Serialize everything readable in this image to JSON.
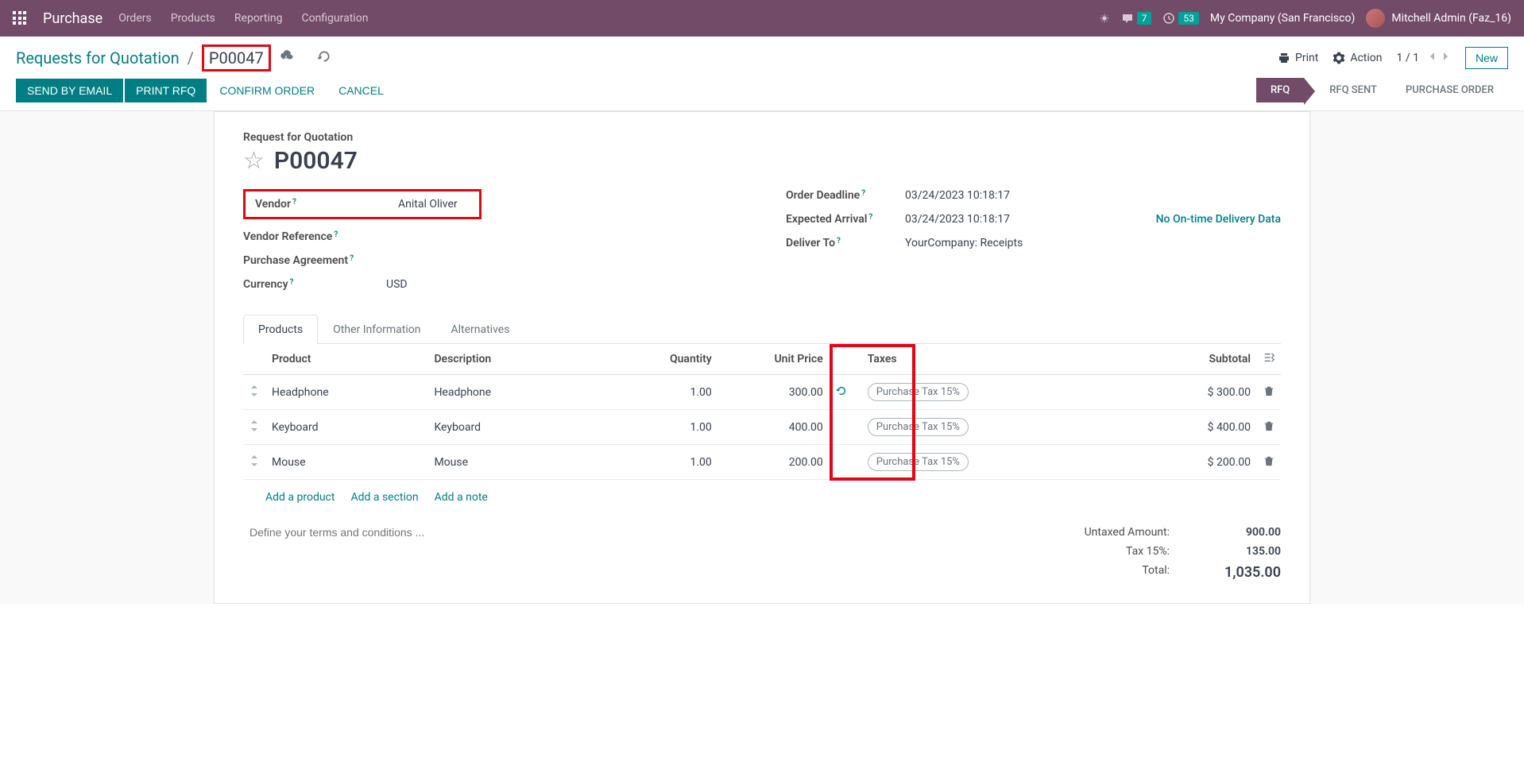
{
  "navbar": {
    "brand": "Purchase",
    "menu": [
      "Orders",
      "Products",
      "Reporting",
      "Configuration"
    ],
    "messages_badge": "7",
    "activities_badge": "53",
    "company": "My Company (San Francisco)",
    "user": "Mitchell Admin (Faz_16)"
  },
  "breadcrumb": {
    "root": "Requests for Quotation",
    "current": "P00047"
  },
  "header_actions": {
    "print": "Print",
    "action": "Action",
    "pager": "1 / 1",
    "new": "New"
  },
  "buttons": {
    "send_email": "SEND BY EMAIL",
    "print_rfq": "PRINT RFQ",
    "confirm": "CONFIRM ORDER",
    "cancel": "CANCEL"
  },
  "status": [
    "RFQ",
    "RFQ SENT",
    "PURCHASE ORDER"
  ],
  "form": {
    "title_label": "Request for Quotation",
    "title": "P00047",
    "labels": {
      "vendor": "Vendor",
      "vendor_ref": "Vendor Reference",
      "purchase_agreement": "Purchase Agreement",
      "currency": "Currency",
      "order_deadline": "Order Deadline",
      "expected_arrival": "Expected Arrival",
      "deliver_to": "Deliver To"
    },
    "values": {
      "vendor": "Anital Oliver",
      "currency": "USD",
      "order_deadline": "03/24/2023 10:18:17",
      "expected_arrival": "03/24/2023 10:18:17",
      "deliver_to": "YourCompany: Receipts",
      "no_ontime": "No On-time Delivery Data"
    }
  },
  "tabs": [
    "Products",
    "Other Information",
    "Alternatives"
  ],
  "table": {
    "headers": {
      "product": "Product",
      "description": "Description",
      "quantity": "Quantity",
      "unit_price": "Unit Price",
      "taxes": "Taxes",
      "subtotal": "Subtotal"
    },
    "rows": [
      {
        "product": "Headphone",
        "description": "Headphone",
        "qty": "1.00",
        "price": "300.00",
        "tax": "Purchase Tax 15%",
        "subtotal": "$ 300.00"
      },
      {
        "product": "Keyboard",
        "description": "Keyboard",
        "qty": "1.00",
        "price": "400.00",
        "tax": "Purchase Tax 15%",
        "subtotal": "$ 400.00"
      },
      {
        "product": "Mouse",
        "description": "Mouse",
        "qty": "1.00",
        "price": "200.00",
        "tax": "Purchase Tax 15%",
        "subtotal": "$ 200.00"
      }
    ],
    "add_links": {
      "product": "Add a product",
      "section": "Add a section",
      "note": "Add a note"
    },
    "terms_placeholder": "Define your terms and conditions ..."
  },
  "totals": {
    "untaxed_label": "Untaxed Amount:",
    "untaxed_value": "900.00",
    "tax_label": "Tax 15%:",
    "tax_value": "135.00",
    "total_label": "Total:",
    "total_value": "1,035.00"
  }
}
